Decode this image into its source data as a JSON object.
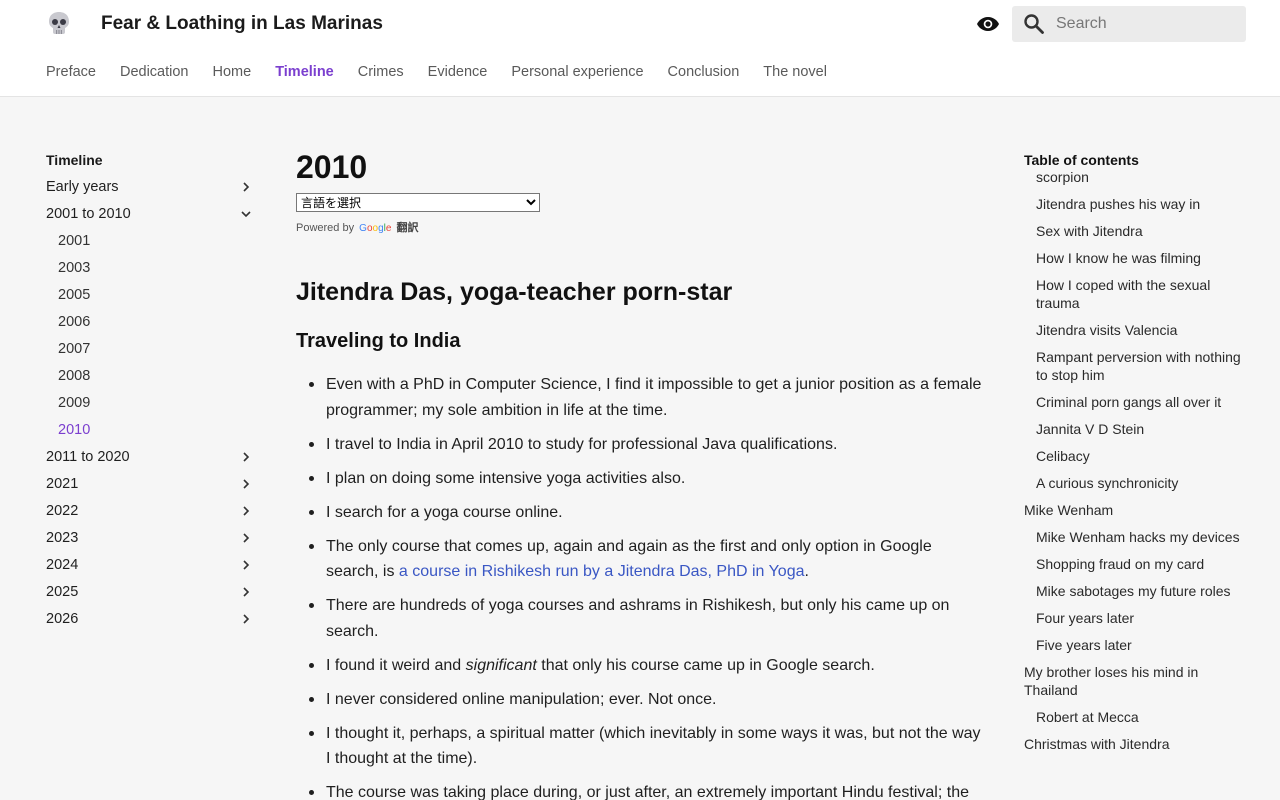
{
  "site": {
    "title": "Fear & Loathing in Las Marinas"
  },
  "search": {
    "placeholder": "Search"
  },
  "tabs": [
    {
      "label": "Preface"
    },
    {
      "label": "Dedication"
    },
    {
      "label": "Home"
    },
    {
      "label": "Timeline",
      "active": true
    },
    {
      "label": "Crimes"
    },
    {
      "label": "Evidence"
    },
    {
      "label": "Personal experience"
    },
    {
      "label": "Conclusion"
    },
    {
      "label": "The novel"
    }
  ],
  "nav": {
    "title": "Timeline",
    "items": [
      {
        "label": "Early years",
        "chevron": "chevron-right"
      },
      {
        "label": "2001 to 2010",
        "chevron": "chevron-down"
      },
      {
        "label": "2001",
        "sub": true
      },
      {
        "label": "2003",
        "sub": true
      },
      {
        "label": "2005",
        "sub": true
      },
      {
        "label": "2006",
        "sub": true
      },
      {
        "label": "2007",
        "sub": true
      },
      {
        "label": "2008",
        "sub": true
      },
      {
        "label": "2009",
        "sub": true
      },
      {
        "label": "2010",
        "sub": true,
        "current": true
      },
      {
        "label": "2011 to 2020",
        "chevron": "chevron-right"
      },
      {
        "label": "2021",
        "chevron": "chevron-right"
      },
      {
        "label": "2022",
        "chevron": "chevron-right"
      },
      {
        "label": "2023",
        "chevron": "chevron-right"
      },
      {
        "label": "2024",
        "chevron": "chevron-right"
      },
      {
        "label": "2025",
        "chevron": "chevron-right"
      },
      {
        "label": "2026",
        "chevron": "chevron-right"
      }
    ]
  },
  "main": {
    "title": "2010",
    "language_select": "言語を選択",
    "powered_by": "Powered by",
    "google": "Google",
    "translate": "翻訳",
    "heading": "Jitendra Das, yoga-teacher porn-star",
    "subheading": "Traveling to India",
    "bullets": {
      "b1": "Even with a PhD in Computer Science, I find it impossible to get a junior position as a female programmer; my sole ambition in life at the time.",
      "b2": "I travel to India in April 2010 to study for professional Java qualifications.",
      "b3": "I plan on doing some intensive yoga activities also.",
      "b4": "I search for a yoga course online.",
      "b5_pre": "The only course that comes up, again and again as the first and only option in Google search, is ",
      "b5_link": "a course in Rishikesh run by a Jitendra Das, PhD in Yoga",
      "b5_post": ".",
      "b6": "There are hundreds of yoga courses and ashrams in Rishikesh, but only his came up on search.",
      "b7_pre": "I found it weird and ",
      "b7_em": "significant",
      "b7_post": " that only his course came up in Google search.",
      "b8": "I never considered online manipulation; ever. Not once.",
      "b9": "I thought it, perhaps, a spiritual matter (which inevitably in some ways it was, but not the way I thought at the time).",
      "b10": "The course was taking place during, or just after, an extremely important Hindu festival; the"
    }
  },
  "toc": {
    "title": "Table of contents",
    "items": [
      {
        "label": "scorpion",
        "level": 2
      },
      {
        "label": "Jitendra pushes his way in",
        "level": 2
      },
      {
        "label": "Sex with Jitendra",
        "level": 2
      },
      {
        "label": "How I know he was filming",
        "level": 2
      },
      {
        "label": "How I coped with the sexual trauma",
        "level": 2
      },
      {
        "label": "Jitendra visits Valencia",
        "level": 2
      },
      {
        "label": "Rampant perversion with nothing to stop him",
        "level": 2
      },
      {
        "label": "Criminal porn gangs all over it",
        "level": 2
      },
      {
        "label": "Jannita V D Stein",
        "level": 2
      },
      {
        "label": "Celibacy",
        "level": 2
      },
      {
        "label": "A curious synchronicity",
        "level": 2
      },
      {
        "label": "Mike Wenham",
        "level": 1
      },
      {
        "label": "Mike Wenham hacks my devices",
        "level": 2
      },
      {
        "label": "Shopping fraud on my card",
        "level": 2
      },
      {
        "label": "Mike sabotages my future roles",
        "level": 2
      },
      {
        "label": "Four years later",
        "level": 2
      },
      {
        "label": "Five years later",
        "level": 2
      },
      {
        "label": "My brother loses his mind in Thailand",
        "level": 1
      },
      {
        "label": "Robert at Mecca",
        "level": 2
      },
      {
        "label": "Christmas with Jitendra",
        "level": 1
      }
    ]
  },
  "colors": {
    "accent": "#7b3fcf",
    "link": "#3a57c4"
  },
  "icons": {
    "logo": "skull-icon",
    "theme": "eye-icon",
    "search": "search-icon"
  }
}
